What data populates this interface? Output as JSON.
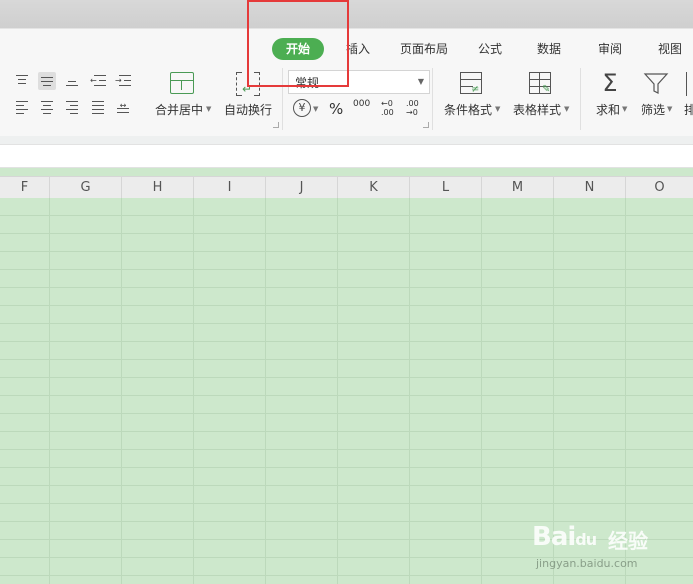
{
  "tabs": [
    {
      "label": "开始",
      "active": true
    },
    {
      "label": "插入"
    },
    {
      "label": "页面布局"
    },
    {
      "label": "公式"
    },
    {
      "label": "数据"
    },
    {
      "label": "审阅"
    },
    {
      "label": "视图"
    }
  ],
  "toolbar": {
    "merge_center": "合并居中",
    "wrap_text": "自动换行",
    "number_format": "常规",
    "currency_symbol": "¥",
    "percent_symbol": "%",
    "thousands_symbol": "000",
    "inc_decimal": "←0 .00",
    "dec_decimal": ".00 →0",
    "conditional_format": "条件格式",
    "table_style": "表格样式",
    "sum": "求和",
    "filter": "筛选",
    "sort_partial": "排"
  },
  "columns": [
    "F",
    "G",
    "H",
    "I",
    "J",
    "K",
    "L",
    "M",
    "N",
    "O"
  ],
  "colors": {
    "accent": "#4cae52",
    "grid_fill": "#cde8cc",
    "highlight": "#e53a3a"
  },
  "watermark": {
    "brand": "Bai",
    "brand2": "du",
    "service": "经验",
    "url": "jingyan.baidu.com"
  }
}
